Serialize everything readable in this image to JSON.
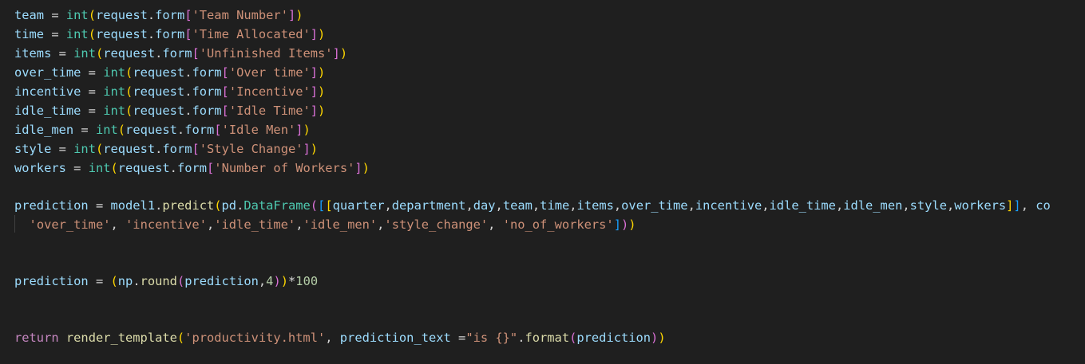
{
  "editor": {
    "theme": {
      "background": "#1f1f1f",
      "foreground": "#d4d4d4"
    },
    "lines": [
      {
        "tokens": [
          {
            "t": "team",
            "c": "var"
          },
          {
            "t": " = ",
            "c": "op"
          },
          {
            "t": "int",
            "c": "class"
          },
          {
            "t": "(",
            "c": "b1"
          },
          {
            "t": "request",
            "c": "var"
          },
          {
            "t": ".",
            "c": "op"
          },
          {
            "t": "form",
            "c": "var"
          },
          {
            "t": "[",
            "c": "b2"
          },
          {
            "t": "'Team Number'",
            "c": "str"
          },
          {
            "t": "]",
            "c": "b2"
          },
          {
            "t": ")",
            "c": "b1"
          }
        ]
      },
      {
        "tokens": [
          {
            "t": "time",
            "c": "var"
          },
          {
            "t": " = ",
            "c": "op"
          },
          {
            "t": "int",
            "c": "class"
          },
          {
            "t": "(",
            "c": "b1"
          },
          {
            "t": "request",
            "c": "var"
          },
          {
            "t": ".",
            "c": "op"
          },
          {
            "t": "form",
            "c": "var"
          },
          {
            "t": "[",
            "c": "b2"
          },
          {
            "t": "'Time Allocated'",
            "c": "str"
          },
          {
            "t": "]",
            "c": "b2"
          },
          {
            "t": ")",
            "c": "b1"
          }
        ]
      },
      {
        "tokens": [
          {
            "t": "items",
            "c": "var"
          },
          {
            "t": " = ",
            "c": "op"
          },
          {
            "t": "int",
            "c": "class"
          },
          {
            "t": "(",
            "c": "b1"
          },
          {
            "t": "request",
            "c": "var"
          },
          {
            "t": ".",
            "c": "op"
          },
          {
            "t": "form",
            "c": "var"
          },
          {
            "t": "[",
            "c": "b2"
          },
          {
            "t": "'Unfinished Items'",
            "c": "str"
          },
          {
            "t": "]",
            "c": "b2"
          },
          {
            "t": ")",
            "c": "b1"
          }
        ]
      },
      {
        "tokens": [
          {
            "t": "over_time",
            "c": "var"
          },
          {
            "t": " = ",
            "c": "op"
          },
          {
            "t": "int",
            "c": "class"
          },
          {
            "t": "(",
            "c": "b1"
          },
          {
            "t": "request",
            "c": "var"
          },
          {
            "t": ".",
            "c": "op"
          },
          {
            "t": "form",
            "c": "var"
          },
          {
            "t": "[",
            "c": "b2"
          },
          {
            "t": "'Over time'",
            "c": "str"
          },
          {
            "t": "]",
            "c": "b2"
          },
          {
            "t": ")",
            "c": "b1"
          }
        ]
      },
      {
        "tokens": [
          {
            "t": "incentive",
            "c": "var"
          },
          {
            "t": " = ",
            "c": "op"
          },
          {
            "t": "int",
            "c": "class"
          },
          {
            "t": "(",
            "c": "b1"
          },
          {
            "t": "request",
            "c": "var"
          },
          {
            "t": ".",
            "c": "op"
          },
          {
            "t": "form",
            "c": "var"
          },
          {
            "t": "[",
            "c": "b2"
          },
          {
            "t": "'Incentive'",
            "c": "str"
          },
          {
            "t": "]",
            "c": "b2"
          },
          {
            "t": ")",
            "c": "b1"
          }
        ]
      },
      {
        "tokens": [
          {
            "t": "idle_time",
            "c": "var"
          },
          {
            "t": " = ",
            "c": "op"
          },
          {
            "t": "int",
            "c": "class"
          },
          {
            "t": "(",
            "c": "b1"
          },
          {
            "t": "request",
            "c": "var"
          },
          {
            "t": ".",
            "c": "op"
          },
          {
            "t": "form",
            "c": "var"
          },
          {
            "t": "[",
            "c": "b2"
          },
          {
            "t": "'Idle Time'",
            "c": "str"
          },
          {
            "t": "]",
            "c": "b2"
          },
          {
            "t": ")",
            "c": "b1"
          }
        ]
      },
      {
        "tokens": [
          {
            "t": "idle_men",
            "c": "var"
          },
          {
            "t": " = ",
            "c": "op"
          },
          {
            "t": "int",
            "c": "class"
          },
          {
            "t": "(",
            "c": "b1"
          },
          {
            "t": "request",
            "c": "var"
          },
          {
            "t": ".",
            "c": "op"
          },
          {
            "t": "form",
            "c": "var"
          },
          {
            "t": "[",
            "c": "b2"
          },
          {
            "t": "'Idle Men'",
            "c": "str"
          },
          {
            "t": "]",
            "c": "b2"
          },
          {
            "t": ")",
            "c": "b1"
          }
        ]
      },
      {
        "tokens": [
          {
            "t": "style",
            "c": "var"
          },
          {
            "t": " = ",
            "c": "op"
          },
          {
            "t": "int",
            "c": "class"
          },
          {
            "t": "(",
            "c": "b1"
          },
          {
            "t": "request",
            "c": "var"
          },
          {
            "t": ".",
            "c": "op"
          },
          {
            "t": "form",
            "c": "var"
          },
          {
            "t": "[",
            "c": "b2"
          },
          {
            "t": "'Style Change'",
            "c": "str"
          },
          {
            "t": "]",
            "c": "b2"
          },
          {
            "t": ")",
            "c": "b1"
          }
        ]
      },
      {
        "tokens": [
          {
            "t": "workers",
            "c": "var"
          },
          {
            "t": " = ",
            "c": "op"
          },
          {
            "t": "int",
            "c": "class"
          },
          {
            "t": "(",
            "c": "b1"
          },
          {
            "t": "request",
            "c": "var"
          },
          {
            "t": ".",
            "c": "op"
          },
          {
            "t": "form",
            "c": "var"
          },
          {
            "t": "[",
            "c": "b2"
          },
          {
            "t": "'Number of Workers'",
            "c": "str"
          },
          {
            "t": "]",
            "c": "b2"
          },
          {
            "t": ")",
            "c": "b1"
          }
        ]
      },
      {
        "tokens": []
      },
      {
        "tokens": [
          {
            "t": "prediction",
            "c": "var"
          },
          {
            "t": " = ",
            "c": "op"
          },
          {
            "t": "model1",
            "c": "var"
          },
          {
            "t": ".",
            "c": "op"
          },
          {
            "t": "predict",
            "c": "func"
          },
          {
            "t": "(",
            "c": "b1"
          },
          {
            "t": "pd",
            "c": "var"
          },
          {
            "t": ".",
            "c": "op"
          },
          {
            "t": "DataFrame",
            "c": "class"
          },
          {
            "t": "(",
            "c": "b2"
          },
          {
            "t": "[",
            "c": "b3"
          },
          {
            "t": "[",
            "c": "b1"
          },
          {
            "t": "quarter",
            "c": "var"
          },
          {
            "t": ",",
            "c": "op"
          },
          {
            "t": "department",
            "c": "var"
          },
          {
            "t": ",",
            "c": "op"
          },
          {
            "t": "day",
            "c": "var"
          },
          {
            "t": ",",
            "c": "op"
          },
          {
            "t": "team",
            "c": "var"
          },
          {
            "t": ",",
            "c": "op"
          },
          {
            "t": "time",
            "c": "var"
          },
          {
            "t": ",",
            "c": "op"
          },
          {
            "t": "items",
            "c": "var"
          },
          {
            "t": ",",
            "c": "op"
          },
          {
            "t": "over_time",
            "c": "var"
          },
          {
            "t": ",",
            "c": "op"
          },
          {
            "t": "incentive",
            "c": "var"
          },
          {
            "t": ",",
            "c": "op"
          },
          {
            "t": "idle_time",
            "c": "var"
          },
          {
            "t": ",",
            "c": "op"
          },
          {
            "t": "idle_men",
            "c": "var"
          },
          {
            "t": ",",
            "c": "op"
          },
          {
            "t": "style",
            "c": "var"
          },
          {
            "t": ",",
            "c": "op"
          },
          {
            "t": "workers",
            "c": "var"
          },
          {
            "t": "]",
            "c": "b1"
          },
          {
            "t": "]",
            "c": "b3"
          },
          {
            "t": ", ",
            "c": "op"
          },
          {
            "t": "co",
            "c": "var"
          }
        ]
      },
      {
        "tokens": [
          {
            "t": "  ",
            "c": "op"
          },
          {
            "t": "'over_time'",
            "c": "str"
          },
          {
            "t": ", ",
            "c": "op"
          },
          {
            "t": "'incentive'",
            "c": "str"
          },
          {
            "t": ",",
            "c": "op"
          },
          {
            "t": "'idle_time'",
            "c": "str"
          },
          {
            "t": ",",
            "c": "op"
          },
          {
            "t": "'idle_men'",
            "c": "str"
          },
          {
            "t": ",",
            "c": "op"
          },
          {
            "t": "'style_change'",
            "c": "str"
          },
          {
            "t": ", ",
            "c": "op"
          },
          {
            "t": "'no_of_workers'",
            "c": "str"
          },
          {
            "t": "]",
            "c": "b3"
          },
          {
            "t": ")",
            "c": "b2"
          },
          {
            "t": ")",
            "c": "b1"
          }
        ]
      },
      {
        "tokens": []
      },
      {
        "tokens": []
      },
      {
        "tokens": [
          {
            "t": "prediction",
            "c": "var"
          },
          {
            "t": " = ",
            "c": "op"
          },
          {
            "t": "(",
            "c": "b1"
          },
          {
            "t": "np",
            "c": "var"
          },
          {
            "t": ".",
            "c": "op"
          },
          {
            "t": "round",
            "c": "func"
          },
          {
            "t": "(",
            "c": "b2"
          },
          {
            "t": "prediction",
            "c": "var"
          },
          {
            "t": ",",
            "c": "op"
          },
          {
            "t": "4",
            "c": "num"
          },
          {
            "t": ")",
            "c": "b2"
          },
          {
            "t": ")",
            "c": "b1"
          },
          {
            "t": "*",
            "c": "op"
          },
          {
            "t": "100",
            "c": "num"
          }
        ]
      },
      {
        "tokens": []
      },
      {
        "tokens": []
      },
      {
        "tokens": [
          {
            "t": "return",
            "c": "kw"
          },
          {
            "t": " ",
            "c": "op"
          },
          {
            "t": "render_template",
            "c": "func"
          },
          {
            "t": "(",
            "c": "b1"
          },
          {
            "t": "'productivity.html'",
            "c": "str"
          },
          {
            "t": ", ",
            "c": "op"
          },
          {
            "t": "prediction_text",
            "c": "var"
          },
          {
            "t": " =",
            "c": "op"
          },
          {
            "t": "\"is {}\"",
            "c": "str"
          },
          {
            "t": ".",
            "c": "op"
          },
          {
            "t": "format",
            "c": "func"
          },
          {
            "t": "(",
            "c": "b2"
          },
          {
            "t": "prediction",
            "c": "var"
          },
          {
            "t": ")",
            "c": "b2"
          },
          {
            "t": ")",
            "c": "b1"
          }
        ]
      }
    ]
  }
}
